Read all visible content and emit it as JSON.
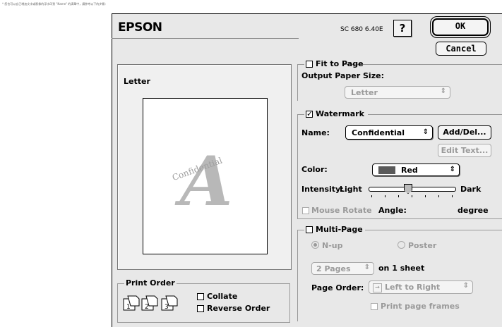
{
  "caption": "* 您也可以自己增加文字或影像的浮水印到 \"Name\" 的清單中，請參考以下的步驟：",
  "dialog": {
    "brand": "EPSON",
    "model": "SC 680 6.40E",
    "help_label": "?",
    "ok_label": "OK",
    "cancel_label": "Cancel"
  },
  "preview": {
    "title": "Letter",
    "watermark_letter": "A",
    "watermark_text": "Confidential"
  },
  "fit_to_page": {
    "label": "Fit to Page",
    "checked": false,
    "output_paper_size_label": "Output Paper Size:",
    "paper_size_value": "Letter"
  },
  "watermark": {
    "label": "Watermark",
    "checked": true,
    "name_label": "Name:",
    "name_value": "Confidential",
    "add_del_label": "Add/Del...",
    "edit_text_label": "Edit Text...",
    "color_label": "Color:",
    "color_value": "Red",
    "color_swatch": "#5a5a5a",
    "intensity_label": "Intensity:",
    "intensity_light": "Light",
    "intensity_dark": "Dark",
    "intensity_level_fraction": 0.45,
    "mouse_rotate_label": "Mouse Rotate",
    "angle_label": "Angle:",
    "angle_unit": "degree"
  },
  "multi_page": {
    "label": "Multi-Page",
    "checked": false,
    "nup_label": "N-up",
    "poster_label": "Poster",
    "pages_value": "2 Pages",
    "on_sheet_label": "on 1 sheet",
    "page_order_label": "Page Order:",
    "page_order_value": "Left to Right",
    "print_frames_label": "Print page frames"
  },
  "print_order": {
    "label": "Print Order",
    "collate_label": "Collate",
    "reverse_label": "Reverse Order",
    "page_numbers": [
      "1",
      "2",
      "3"
    ]
  }
}
